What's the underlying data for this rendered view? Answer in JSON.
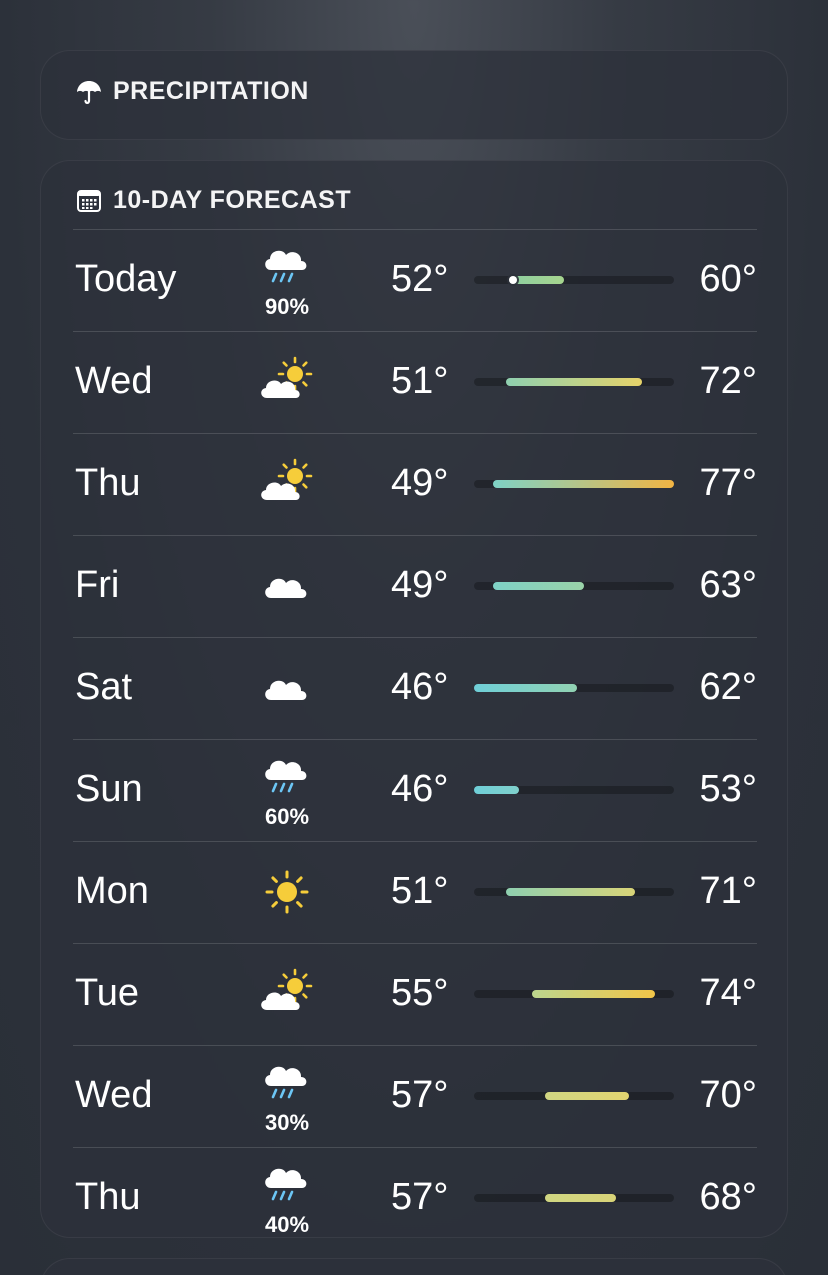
{
  "precipitation": {
    "title": "PRECIPITATION",
    "icon": "umbrella-icon"
  },
  "forecast": {
    "title": "10-DAY FORECAST",
    "icon": "calendar-icon",
    "range_min": 46,
    "range_max": 77,
    "days": [
      {
        "day": "Today",
        "icon": "cloud-rain-icon",
        "precip": "90%",
        "low": "52°",
        "high": "60°",
        "low_val": 52,
        "high_val": 60,
        "current_val": 52,
        "colors": [
          "#8fd0a0",
          "#a6d48e"
        ]
      },
      {
        "day": "Wed",
        "icon": "partly-sunny-icon",
        "precip": "",
        "low": "51°",
        "high": "72°",
        "low_val": 51,
        "high_val": 72,
        "colors": [
          "#8fd0b0",
          "#e6d36a"
        ]
      },
      {
        "day": "Thu",
        "icon": "partly-sunny-icon",
        "precip": "",
        "low": "49°",
        "high": "77°",
        "low_val": 49,
        "high_val": 77,
        "colors": [
          "#7ed2c6",
          "#f2b544"
        ]
      },
      {
        "day": "Fri",
        "icon": "cloud-icon",
        "precip": "",
        "low": "49°",
        "high": "63°",
        "low_val": 49,
        "high_val": 63,
        "colors": [
          "#7ed2c6",
          "#9ad3a8"
        ]
      },
      {
        "day": "Sat",
        "icon": "cloud-icon",
        "precip": "",
        "low": "46°",
        "high": "62°",
        "low_val": 46,
        "high_val": 62,
        "colors": [
          "#6fcfd8",
          "#92d2b2"
        ]
      },
      {
        "day": "Sun",
        "icon": "cloud-rain-icon",
        "precip": "60%",
        "low": "46°",
        "high": "53°",
        "low_val": 46,
        "high_val": 53,
        "colors": [
          "#6fcfd8",
          "#80d0cc"
        ]
      },
      {
        "day": "Mon",
        "icon": "sun-icon",
        "precip": "",
        "low": "51°",
        "high": "71°",
        "low_val": 51,
        "high_val": 71,
        "colors": [
          "#8fd0b0",
          "#d9d478"
        ]
      },
      {
        "day": "Tue",
        "icon": "partly-sunny-icon",
        "precip": "",
        "low": "55°",
        "high": "74°",
        "low_val": 55,
        "high_val": 74,
        "colors": [
          "#bcd68e",
          "#f2c548"
        ]
      },
      {
        "day": "Wed",
        "icon": "cloud-rain-icon",
        "precip": "30%",
        "low": "57°",
        "high": "70°",
        "low_val": 57,
        "high_val": 70,
        "colors": [
          "#d0d682",
          "#e2d470"
        ]
      },
      {
        "day": "Thu",
        "icon": "cloud-rain-icon",
        "precip": "40%",
        "low": "57°",
        "high": "68°",
        "low_val": 57,
        "high_val": 68,
        "colors": [
          "#d0d682",
          "#d9d478"
        ]
      }
    ]
  }
}
